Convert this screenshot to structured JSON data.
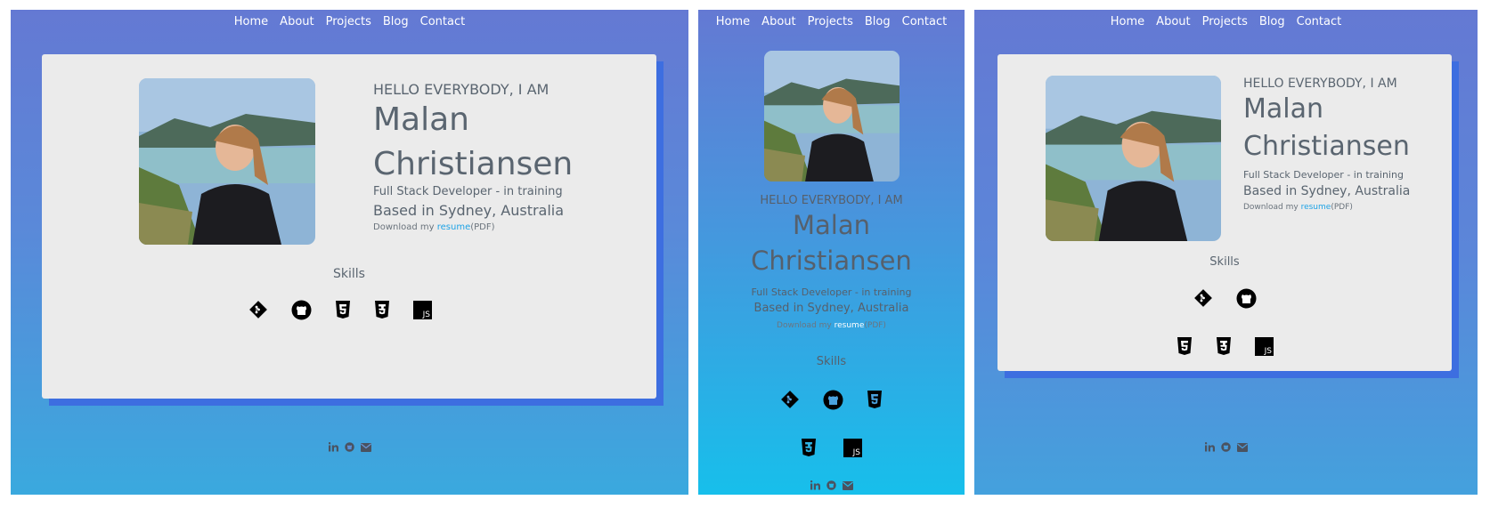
{
  "nav": {
    "home": "Home",
    "about": "About",
    "projects": "Projects",
    "blog": "Blog",
    "contact": "Contact"
  },
  "profile": {
    "greeting": "HELLO EVERYBODY, I AM",
    "first_name": "Malan",
    "last_name": "Christiansen",
    "role": "Full Stack Developer - in training",
    "location": "Based in Sydney, Australia",
    "download_prefix": "Download my",
    "resume_link": "resume",
    "download_suffix": "(PDF)"
  },
  "skills": {
    "heading": "Skills",
    "items": [
      "git-icon",
      "github-icon",
      "html5-icon",
      "css3-icon",
      "javascript-icon"
    ],
    "js_badge": "JS"
  },
  "footer": {
    "icons": [
      "linkedin-icon",
      "github-icon",
      "envelope-icon"
    ]
  },
  "colors": {
    "card": "#ebebeb",
    "link": "#1ea3e6",
    "shadow": "#3d6ee0",
    "nav_text": "#ffffff"
  }
}
